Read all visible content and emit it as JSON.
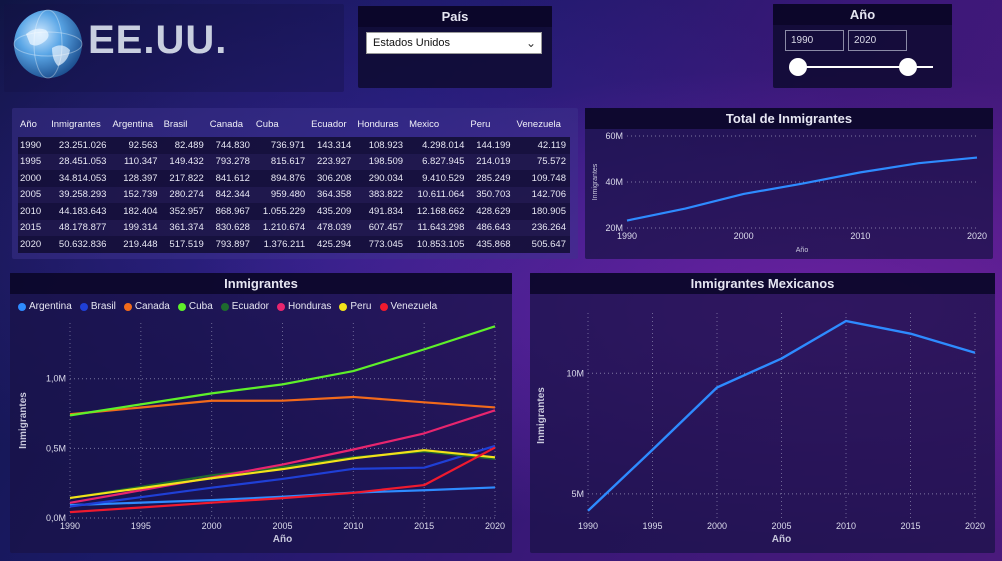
{
  "header": {
    "title": "EE.UU."
  },
  "pais_slicer": {
    "title": "País",
    "selected": "Estados Unidos"
  },
  "anio_slicer": {
    "title": "Año",
    "from": "1990",
    "to": "2020",
    "range": [
      1990,
      2020
    ]
  },
  "table": {
    "columns": [
      "Año",
      "Inmigrantes",
      "Argentina",
      "Brasil",
      "Canada",
      "Cuba",
      "Ecuador",
      "Honduras",
      "Mexico",
      "Peru",
      "Venezuela"
    ],
    "rows": [
      [
        "1990",
        "23.251.026",
        "92.563",
        "82.489",
        "744.830",
        "736.971",
        "143.314",
        "108.923",
        "4.298.014",
        "144.199",
        "42.119"
      ],
      [
        "1995",
        "28.451.053",
        "110.347",
        "149.432",
        "793.278",
        "815.617",
        "223.927",
        "198.509",
        "6.827.945",
        "214.019",
        "75.572"
      ],
      [
        "2000",
        "34.814.053",
        "128.397",
        "217.822",
        "841.612",
        "894.876",
        "306.208",
        "290.034",
        "9.410.529",
        "285.249",
        "109.748"
      ],
      [
        "2005",
        "39.258.293",
        "152.739",
        "280.274",
        "842.344",
        "959.480",
        "364.358",
        "383.822",
        "10.611.064",
        "350.703",
        "142.706"
      ],
      [
        "2010",
        "44.183.643",
        "182.404",
        "352.957",
        "868.967",
        "1.055.229",
        "435.209",
        "491.834",
        "12.168.662",
        "428.629",
        "180.905"
      ],
      [
        "2015",
        "48.178.877",
        "199.314",
        "361.374",
        "830.628",
        "1.210.674",
        "478.039",
        "607.457",
        "11.643.298",
        "486.643",
        "236.264"
      ],
      [
        "2020",
        "50.632.836",
        "219.448",
        "517.519",
        "793.897",
        "1.376.211",
        "425.294",
        "773.045",
        "10.853.105",
        "435.868",
        "505.647"
      ]
    ]
  },
  "chart_data": [
    {
      "type": "line",
      "title": "Total de Inmigrantes",
      "xlabel": "Año",
      "ylabel": "Inmigrantes",
      "x": [
        1990,
        1995,
        2000,
        2005,
        2010,
        2015,
        2020
      ],
      "x_ticks": [
        "1990",
        "2000",
        "2010",
        "2020"
      ],
      "y_ticks": [
        "20M",
        "40M",
        "60M"
      ],
      "y_tick_values": [
        20000000,
        40000000,
        60000000
      ],
      "ylim": [
        20000000,
        60000000
      ],
      "series": [
        {
          "color": "#2e8bff",
          "values": [
            23251026,
            28451053,
            34814053,
            39258293,
            44183643,
            48178877,
            50632836
          ]
        }
      ]
    },
    {
      "type": "line",
      "title": "Inmigrantes",
      "xlabel": "Año",
      "ylabel": "Inmigrantes",
      "x": [
        1990,
        1995,
        2000,
        2005,
        2010,
        2015,
        2020
      ],
      "x_ticks": [
        "1990",
        "1995",
        "2000",
        "2005",
        "2010",
        "2015",
        "2020"
      ],
      "y_ticks": [
        "0,0M",
        "0,5M",
        "1,0M"
      ],
      "y_tick_values": [
        0,
        500000,
        1000000
      ],
      "ylim": [
        0,
        1400000
      ],
      "legend_position": "top-left",
      "series": [
        {
          "name": "Argentina",
          "color": "#2e8bff",
          "values": [
            92563,
            110347,
            128397,
            152739,
            182404,
            199314,
            219448
          ]
        },
        {
          "name": "Brasil",
          "color": "#1f3fd6",
          "values": [
            82489,
            149432,
            217822,
            280274,
            352957,
            361374,
            517519
          ]
        },
        {
          "name": "Canada",
          "color": "#f26a1b",
          "values": [
            744830,
            793278,
            841612,
            842344,
            868967,
            830628,
            793897
          ]
        },
        {
          "name": "Cuba",
          "color": "#5ef02a",
          "values": [
            736971,
            815617,
            894876,
            959480,
            1055229,
            1210674,
            1376211
          ]
        },
        {
          "name": "Ecuador",
          "color": "#1e6b2e",
          "values": [
            143314,
            223927,
            306208,
            364358,
            435209,
            478039,
            425294
          ]
        },
        {
          "name": "Honduras",
          "color": "#e8256e",
          "values": [
            108923,
            198509,
            290034,
            383822,
            491834,
            607457,
            773045
          ]
        },
        {
          "name": "Peru",
          "color": "#f2e21a",
          "values": [
            144199,
            214019,
            285249,
            350703,
            428629,
            486643,
            435868
          ]
        },
        {
          "name": "Venezuela",
          "color": "#f01a2e",
          "values": [
            42119,
            75572,
            109748,
            142706,
            180905,
            236264,
            505647
          ]
        }
      ]
    },
    {
      "type": "line",
      "title": "Inmigrantes Mexicanos",
      "xlabel": "Año",
      "ylabel": "Inmigrantes",
      "x": [
        1990,
        1995,
        2000,
        2005,
        2010,
        2015,
        2020
      ],
      "x_ticks": [
        "1990",
        "1995",
        "2000",
        "2005",
        "2010",
        "2015",
        "2020"
      ],
      "y_ticks": [
        "5M",
        "10M"
      ],
      "y_tick_values": [
        5000000,
        10000000
      ],
      "ylim": [
        4000000,
        12500000
      ],
      "series": [
        {
          "color": "#2e8bff",
          "values": [
            4298014,
            6827945,
            9410529,
            10611064,
            12168662,
            11643298,
            10853105
          ]
        }
      ]
    }
  ]
}
